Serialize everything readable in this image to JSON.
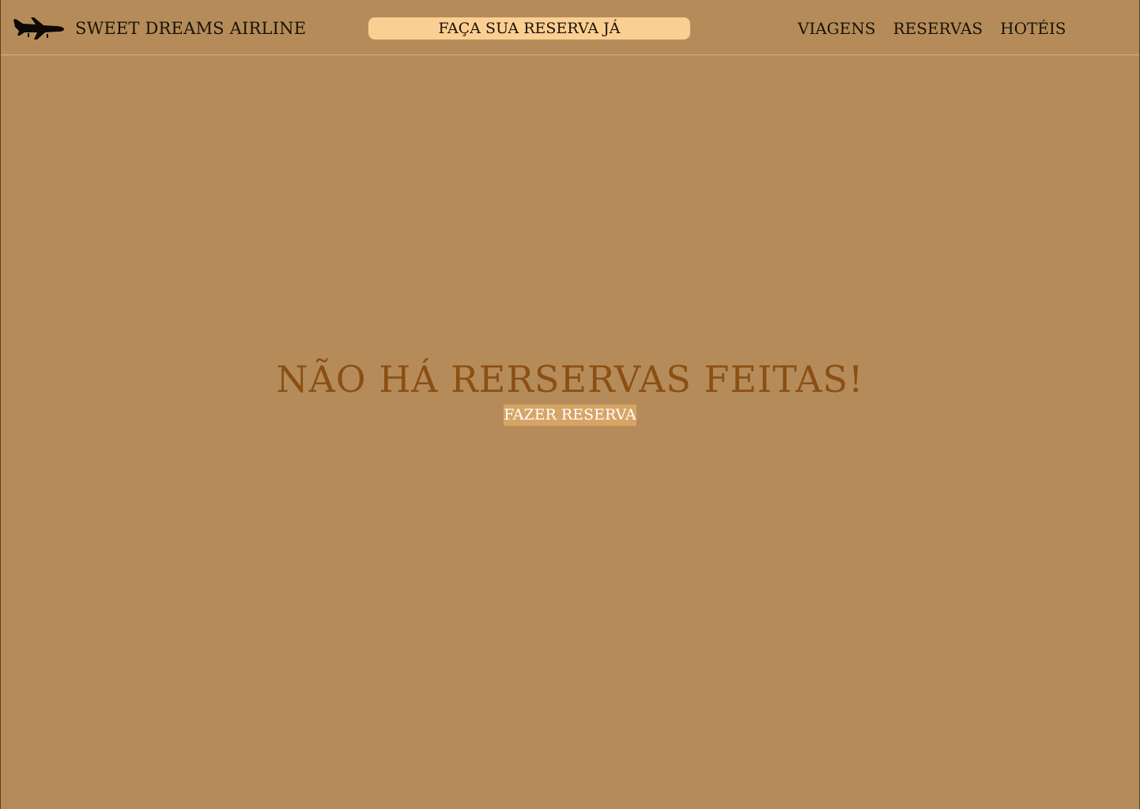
{
  "header": {
    "brand": "SWEET DREAMS AIRLINE",
    "cta_label": "FAÇA SUA RESERVA JÁ",
    "nav": [
      {
        "label": "VIAGENS"
      },
      {
        "label": "RESERVAS"
      },
      {
        "label": "HOTÉIS"
      }
    ]
  },
  "main": {
    "empty_message": "NÃO HÁ RERSERVAS FEITAS!",
    "make_reservation_label": "FAZER RESERVA"
  },
  "colors": {
    "background": "#b58c59",
    "cta_background": "#fbcf92",
    "heading": "#8b4f13",
    "button_background": "#d6a566"
  },
  "icons": {
    "logo": "airplane-icon"
  }
}
